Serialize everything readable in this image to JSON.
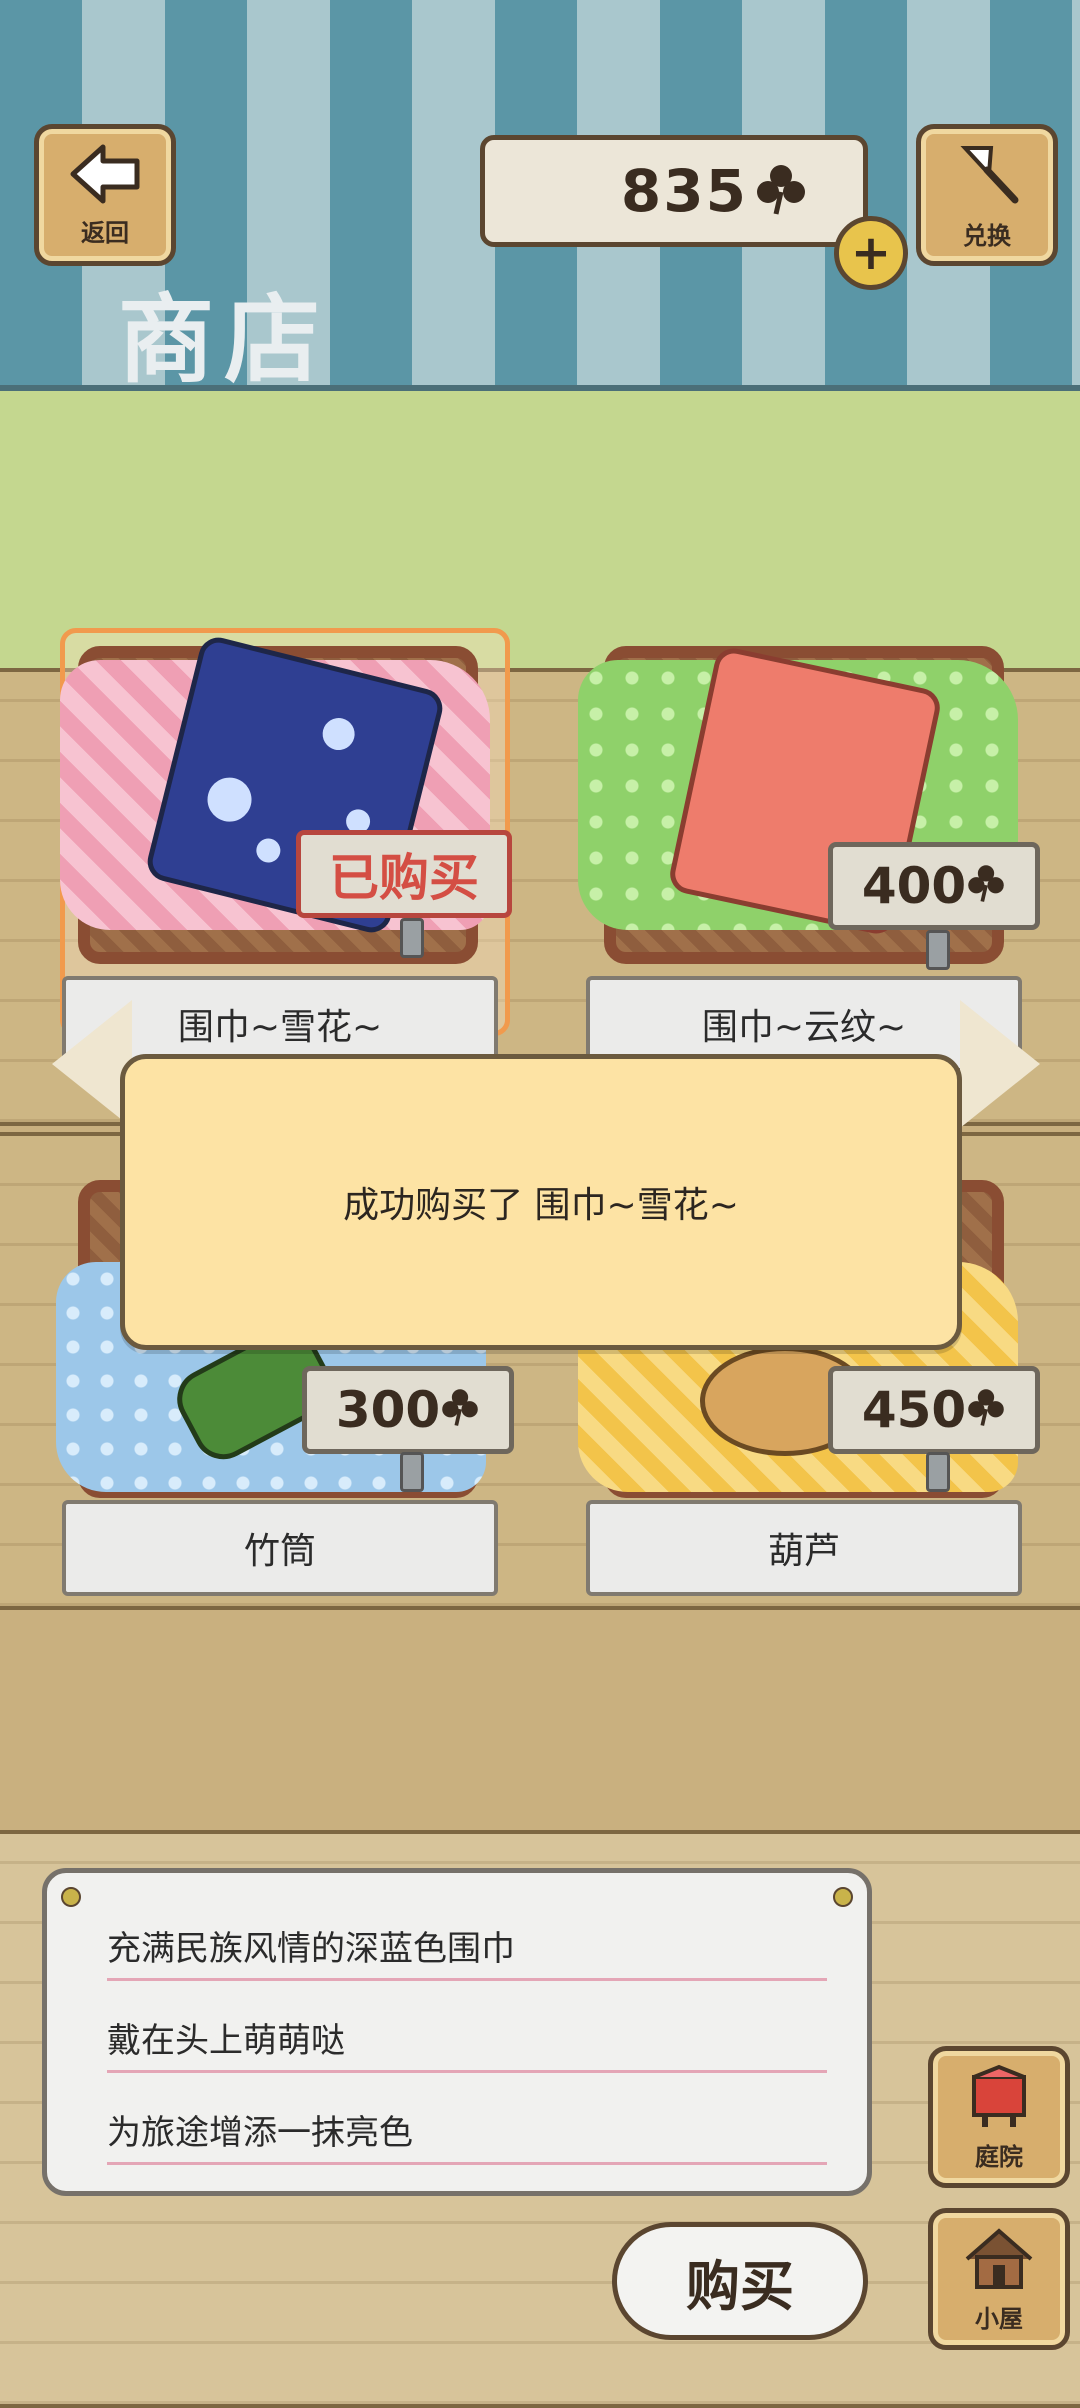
{
  "header": {
    "back_label": "返回",
    "exchange_label": "兑换",
    "coins": "835",
    "title": "商店"
  },
  "items": [
    {
      "name": "围巾~雪花~",
      "status": "已购买",
      "cloth_color": "#ef9fb4",
      "bag_color": "#2f3f92"
    },
    {
      "name": "围巾~云纹~",
      "price": "400",
      "cloth_color": "#8fd16a",
      "bag_color": "#ee7c6c"
    },
    {
      "name": "竹筒",
      "price": "300",
      "cloth_color": "#9cc7e9",
      "bag_color": "#4c8b38"
    },
    {
      "name": "葫芦",
      "price": "450",
      "cloth_color": "#f3c44a",
      "bag_color": "#d8a55e"
    }
  ],
  "popup": {
    "message": "成功购买了 围巾~雪花~"
  },
  "description": {
    "lines": [
      "充满民族风情的深蓝色围巾",
      "戴在头上萌萌哒",
      "为旅途增添一抹亮色"
    ]
  },
  "buy_label": "购买",
  "side_buttons": {
    "yard_label": "庭院",
    "house_label": "小屋"
  },
  "colors": {
    "accent": "#5b96a6",
    "popup_bg": "#fde3a4",
    "wood": "#cdb684"
  }
}
